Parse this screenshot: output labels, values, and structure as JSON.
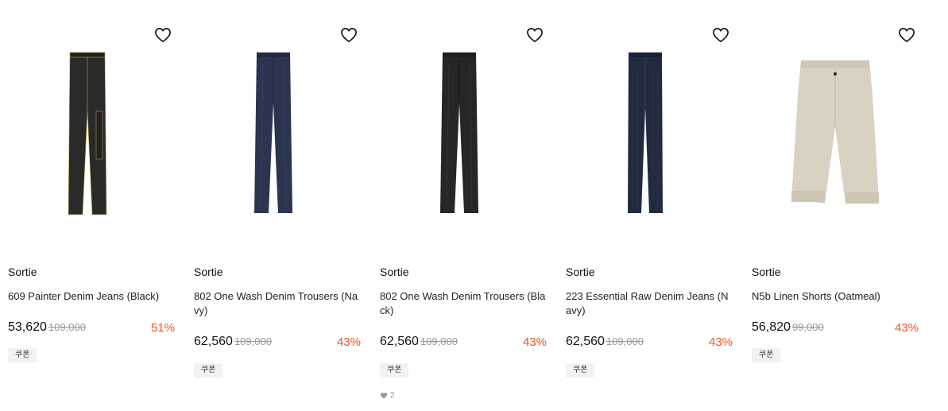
{
  "products": [
    {
      "brand": "Sortie",
      "name": "609 Painter Denim Jeans (Black)",
      "price": "53,620",
      "original_price": "109,000",
      "discount": "51%",
      "coupon": "쿠폰"
    },
    {
      "brand": "Sortie",
      "name": "802 One Wash Denim Trousers (Navy)",
      "price": "62,560",
      "original_price": "109,000",
      "discount": "43%",
      "coupon": "쿠폰"
    },
    {
      "brand": "Sortie",
      "name": "802 One Wash Denim Trousers (Black)",
      "price": "62,560",
      "original_price": "109,000",
      "discount": "43%",
      "coupon": "쿠폰",
      "likes": "2"
    },
    {
      "brand": "Sortie",
      "name": "223 Essential Raw Denim Jeans (Navy)",
      "price": "62,560",
      "original_price": "109,000",
      "discount": "43%",
      "coupon": "쿠폰"
    },
    {
      "brand": "Sortie",
      "name": "N5b Linen Shorts (Oatmeal)",
      "price": "56,820",
      "original_price": "99,000",
      "discount": "43%",
      "coupon": "쿠폰"
    }
  ],
  "colors": {
    "discount": "#f05424",
    "black_denim": "#2a2a28",
    "navy_denim": "#2b3550",
    "oatmeal": "#d9d2c2"
  },
  "icons": {
    "wishlist": "heart-outline-icon",
    "likes": "heart-filled-icon"
  }
}
